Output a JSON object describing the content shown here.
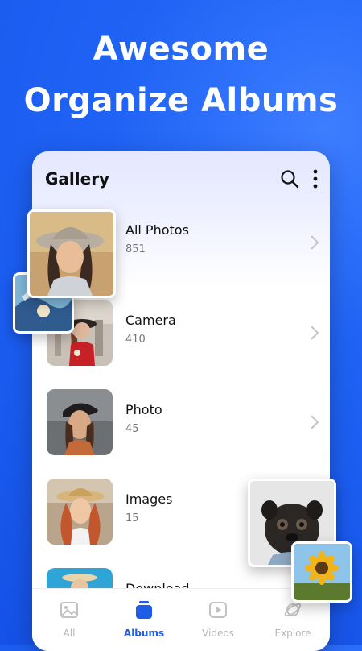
{
  "promo": {
    "line1": "Awesome",
    "line2": "Organize Albums"
  },
  "app": {
    "title": "Gallery"
  },
  "albums": [
    {
      "name": "All Photos",
      "count": "851"
    },
    {
      "name": "Camera",
      "count": "410"
    },
    {
      "name": "Photo",
      "count": "45"
    },
    {
      "name": "Images",
      "count": "15"
    },
    {
      "name": "Download",
      "count": ""
    }
  ],
  "nav": [
    {
      "label": "All",
      "icon": "image-icon"
    },
    {
      "label": "Albums",
      "icon": "albums-icon"
    },
    {
      "label": "Videos",
      "icon": "video-icon"
    },
    {
      "label": "Explore",
      "icon": "planet-icon"
    }
  ],
  "colors": {
    "brand_blue": "#1f5ce8",
    "background_blue": "#1b5cf0"
  }
}
